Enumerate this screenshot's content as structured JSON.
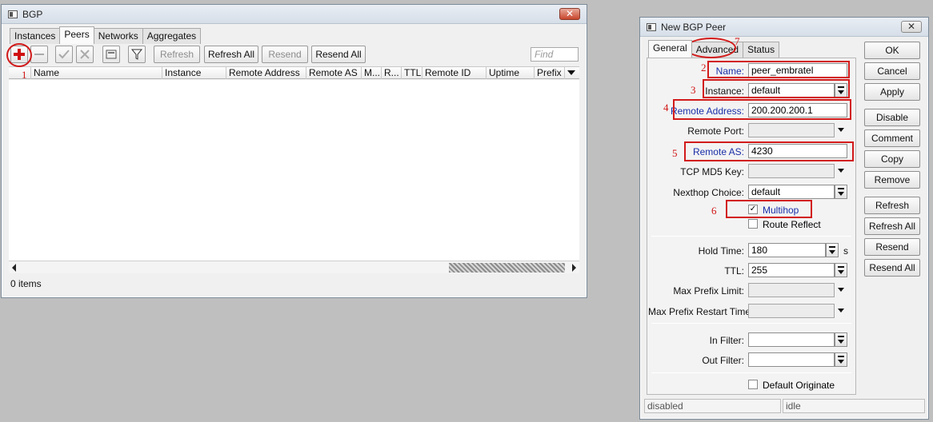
{
  "bgp_window": {
    "title": "BGP",
    "close": "✕",
    "tabs": [
      "Instances",
      "Peers",
      "Networks",
      "Aggregates"
    ],
    "toolbar": {
      "refresh": "Refresh",
      "refresh_all": "Refresh All",
      "resend": "Resend",
      "resend_all": "Resend All",
      "find_placeholder": "Find"
    },
    "columns": [
      "Name",
      "Instance",
      "Remote Address",
      "Remote AS",
      "M...",
      "R...",
      "TTL",
      "Remote ID",
      "Uptime",
      "Prefix C"
    ],
    "status": "0 items"
  },
  "peer_window": {
    "title": "New BGP Peer",
    "close": "✕",
    "tabs": [
      "General",
      "Advanced",
      "Status"
    ],
    "fields": {
      "name": {
        "label": "Name:",
        "value": "peer_embratel"
      },
      "instance": {
        "label": "Instance:",
        "value": "default"
      },
      "remote_address": {
        "label": "Remote Address:",
        "value": "200.200.200.1"
      },
      "remote_port": {
        "label": "Remote Port:",
        "value": ""
      },
      "remote_as": {
        "label": "Remote AS:",
        "value": "4230"
      },
      "tcp_md5_key": {
        "label": "TCP MD5 Key:",
        "value": ""
      },
      "nexthop_choice": {
        "label": "Nexthop Choice:",
        "value": "default"
      },
      "multihop": {
        "label": "Multihop",
        "checked": true,
        "mark": "✓"
      },
      "route_reflect": {
        "label": "Route Reflect",
        "checked": false
      },
      "hold_time": {
        "label": "Hold Time:",
        "value": "180",
        "unit": "s"
      },
      "ttl": {
        "label": "TTL:",
        "value": "255"
      },
      "max_prefix_limit": {
        "label": "Max Prefix Limit:",
        "value": ""
      },
      "max_prefix_restart_time": {
        "label": "Max Prefix Restart Time:",
        "value": ""
      },
      "in_filter": {
        "label": "In Filter:",
        "value": ""
      },
      "out_filter": {
        "label": "Out Filter:",
        "value": ""
      },
      "default_originate": {
        "label": "Default Originate",
        "checked": false
      }
    },
    "buttons": [
      "OK",
      "Cancel",
      "Apply",
      "Disable",
      "Comment",
      "Copy",
      "Remove",
      "Refresh",
      "Refresh All",
      "Resend",
      "Resend All"
    ],
    "status_left": "disabled",
    "status_right": "idle"
  },
  "annotations": [
    "1",
    "2",
    "3",
    "4",
    "5",
    "6",
    "7"
  ],
  "colors": {
    "annotation_red": "#d21a1a",
    "blue_label": "#1a2fa8"
  },
  "icons": [
    "add-icon",
    "remove-icon",
    "enable-icon",
    "disable-icon",
    "comment-icon",
    "filter-icon"
  ]
}
